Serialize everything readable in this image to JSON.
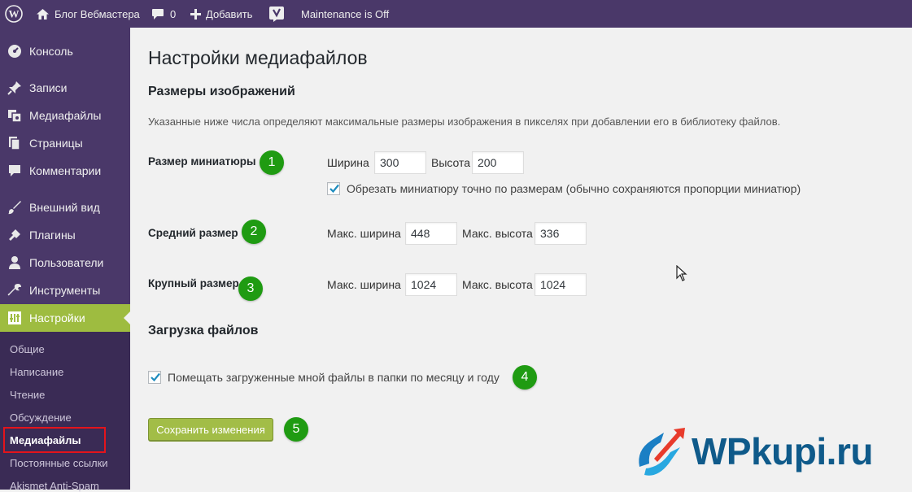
{
  "adminbar": {
    "site_name": "Блог Вебмастера",
    "comments_count": "0",
    "add_label": "Добавить",
    "maintenance_label": "Maintenance is Off"
  },
  "sidebar": {
    "items": [
      {
        "label": "Консоль",
        "icon": "dashboard-icon"
      },
      {
        "label": "Записи",
        "icon": "pin-icon"
      },
      {
        "label": "Медиафайлы",
        "icon": "media-icon"
      },
      {
        "label": "Страницы",
        "icon": "pages-icon"
      },
      {
        "label": "Комментарии",
        "icon": "comment-icon"
      },
      {
        "label": "Внешний вид",
        "icon": "brush-icon"
      },
      {
        "label": "Плагины",
        "icon": "plugin-icon"
      },
      {
        "label": "Пользователи",
        "icon": "user-icon"
      },
      {
        "label": "Инструменты",
        "icon": "wrench-icon"
      },
      {
        "label": "Настройки",
        "icon": "settings-icon"
      }
    ],
    "submenu": [
      "Общие",
      "Написание",
      "Чтение",
      "Обсуждение",
      "Медиафайлы",
      "Постоянные ссылки",
      "Akismet Anti-Spam"
    ],
    "active_submenu": "Медиафайлы"
  },
  "page": {
    "title": "Настройки медиафайлов",
    "image_sizes_title": "Размеры изображений",
    "description": "Указанные ниже числа определяют максимальные размеры изображения в пикселях при добавлении его в библиотеку файлов.",
    "thumbnail": {
      "label": "Размер миниатюры",
      "width_label": "Ширина",
      "width": "300",
      "height_label": "Высота",
      "height": "200",
      "crop_label": "Обрезать миниатюру точно по размерам (обычно сохраняются пропорции миниатюр)",
      "crop_checked": true
    },
    "medium": {
      "label": "Средний размер",
      "width_label": "Макс. ширина",
      "width": "448",
      "height_label": "Макс. высота",
      "height": "336"
    },
    "large": {
      "label": "Крупный размер",
      "width_label": "Макс. ширина",
      "width": "1024",
      "height_label": "Макс. высота",
      "height": "1024"
    },
    "uploads_title": "Загрузка файлов",
    "uploads_checkbox_label": "Помещать загруженные мной файлы в папки по месяцу и году",
    "uploads_checked": true,
    "save_label": "Сохранить изменения"
  },
  "annotations": [
    "1",
    "2",
    "3",
    "4",
    "5"
  ],
  "watermark": "WPkupi.ru",
  "colors": {
    "adminbar_bg": "#4a3869",
    "active_menu": "#9ebc40",
    "badge": "#1f9b12",
    "highlight_border": "#e4141b"
  }
}
